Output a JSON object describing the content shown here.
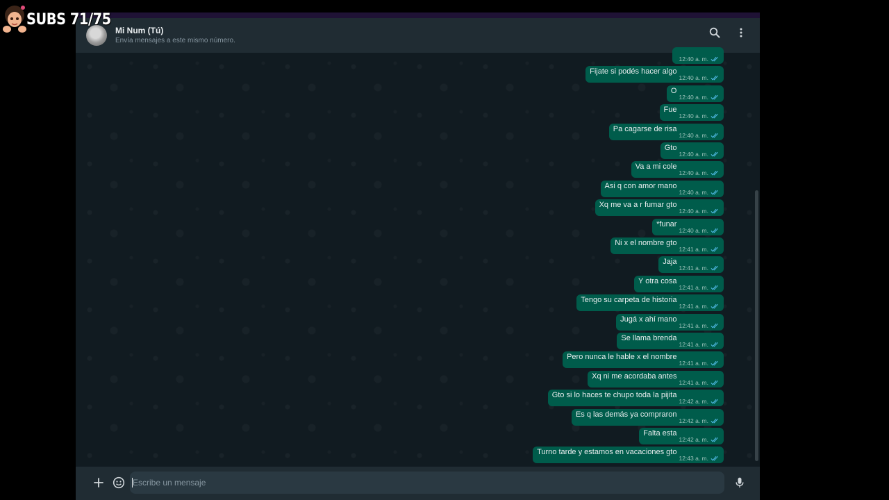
{
  "overlay": {
    "subs_text": "SUBS 71/75"
  },
  "header": {
    "contact_name": "Mi Num (Tú)",
    "subtitle": "Envía mensajes a este mismo número."
  },
  "messages": [
    {
      "text": "",
      "time": "12:40 a. m."
    },
    {
      "text": "Fijate si podés hacer algo",
      "time": "12:40 a. m."
    },
    {
      "text": "O",
      "time": "12:40 a. m."
    },
    {
      "text": "Fue",
      "time": "12:40 a. m."
    },
    {
      "text": "Pa cagarse de risa",
      "time": "12:40 a. m."
    },
    {
      "text": "Gto",
      "time": "12:40 a. m."
    },
    {
      "text": "Va a mi cole",
      "time": "12:40 a. m."
    },
    {
      "text": "Asi q con amor mano",
      "time": "12:40 a. m."
    },
    {
      "text": "Xq me va a r fumar gto",
      "time": "12:40 a. m."
    },
    {
      "text": "*funar",
      "time": "12:40 a. m."
    },
    {
      "text": "Ni x el nombre gto",
      "time": "12:41 a. m."
    },
    {
      "text": "Jaja",
      "time": "12:41 a. m."
    },
    {
      "text": "Y otra cosa",
      "time": "12:41 a. m."
    },
    {
      "text": "Tengo su carpeta de historia",
      "time": "12:41 a. m."
    },
    {
      "text": "Jugá x ahí mano",
      "time": "12:41 a. m."
    },
    {
      "text": "Se llama brenda",
      "time": "12:41 a. m."
    },
    {
      "text": "Pero nunca le hable x el nombre",
      "time": "12:41 a. m."
    },
    {
      "text": "Xq ni me acordaba antes",
      "time": "12:41 a. m."
    },
    {
      "text": "Gto si lo haces te chupo toda la pijita",
      "time": "12:42 a. m."
    },
    {
      "text": "Es q las demás ya compraron",
      "time": "12:42 a. m."
    },
    {
      "text": "Falta esta",
      "time": "12:42 a. m."
    },
    {
      "text": "Turno tarde y estamos en vacaciones gto",
      "time": "12:43 a. m."
    }
  ],
  "composer": {
    "placeholder": "Escribe un mensaje"
  },
  "colors": {
    "outgoing_bubble": "#005c4b",
    "read_ticks": "#53bdeb",
    "background": "#111b21"
  },
  "icons": [
    "search-icon",
    "menu-icon",
    "plus-icon",
    "sticker-icon",
    "mic-icon",
    "double-check-icon"
  ]
}
